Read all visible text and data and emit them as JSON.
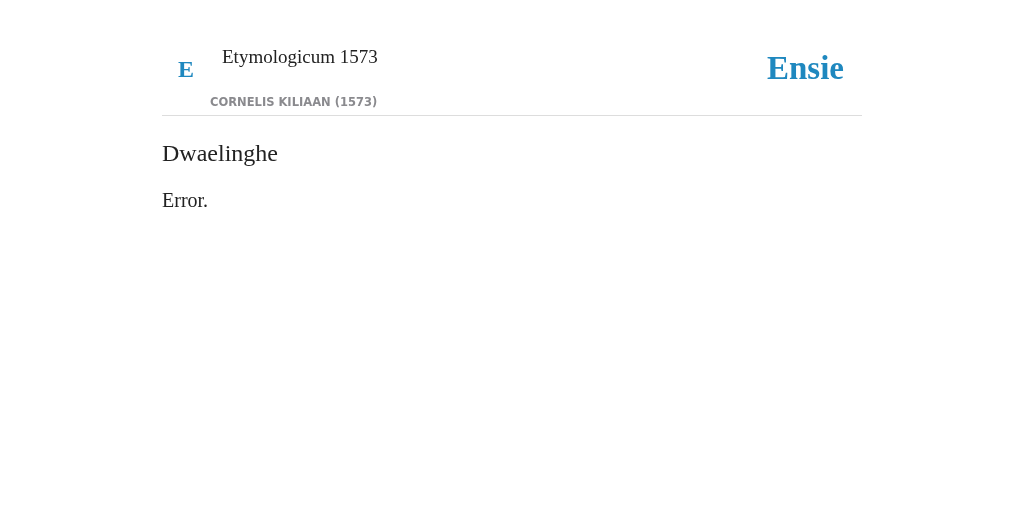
{
  "header": {
    "logo_letter": "E",
    "title": "Etymologicum 1573",
    "subtitle": "CORNELIS KILIAAN (1573)",
    "brand": "Ensie"
  },
  "entry": {
    "term": "Dwaelinghe",
    "definition": "Error."
  }
}
